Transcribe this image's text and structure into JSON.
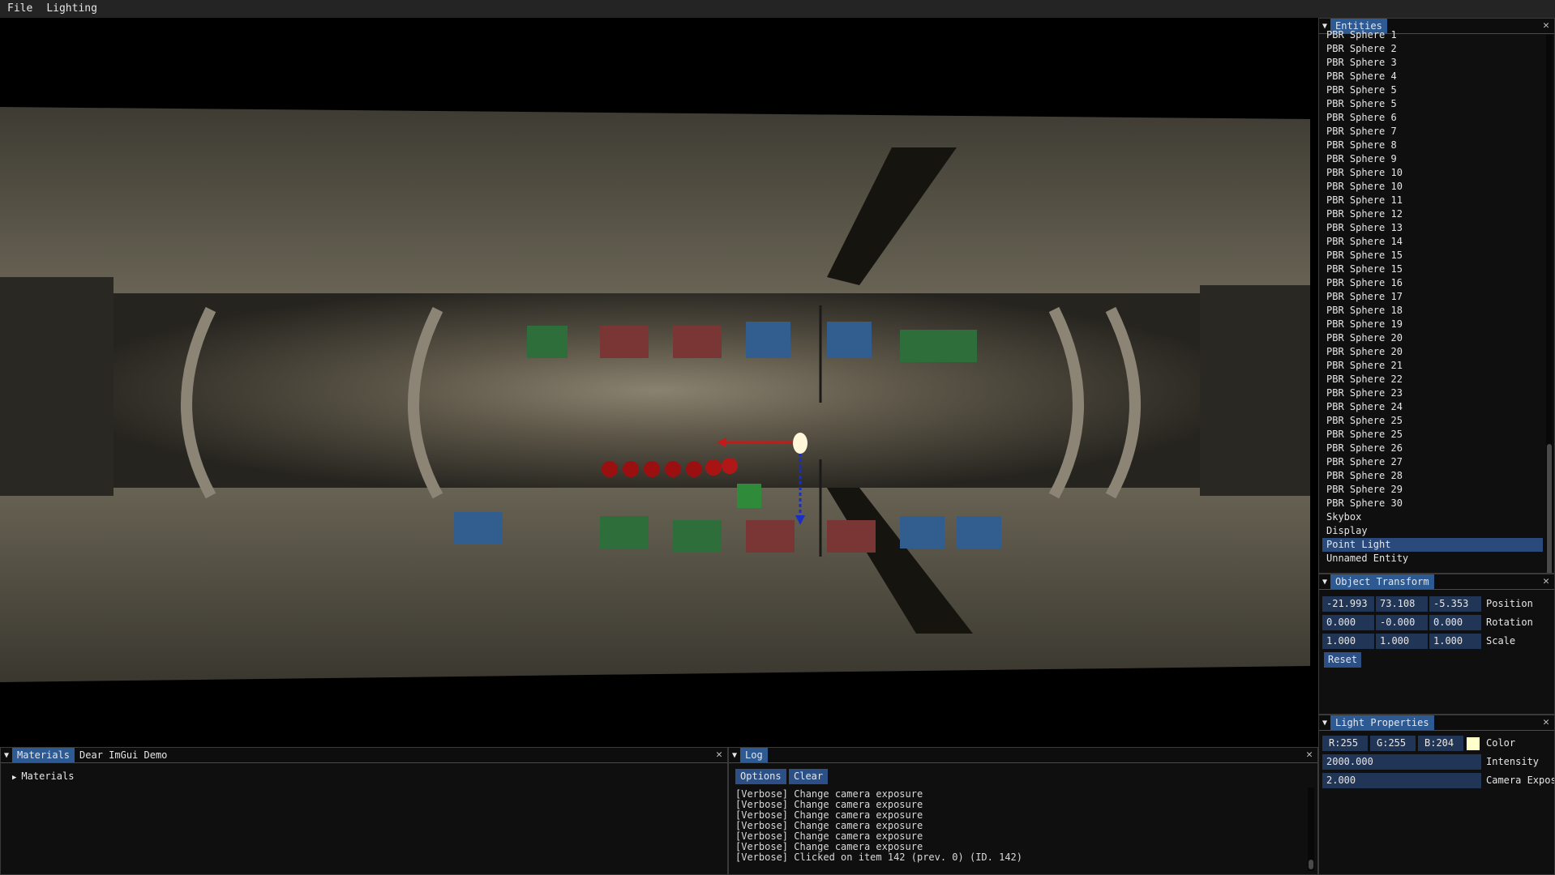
{
  "menu": {
    "items": [
      "File",
      "Lighting"
    ]
  },
  "entities_panel": {
    "title": "Entities",
    "items": [
      "PBR Sphere 1",
      "PBR Sphere 2",
      "PBR Sphere 3",
      "PBR Sphere 4",
      "PBR Sphere 5",
      "PBR Sphere 5",
      "PBR Sphere 6",
      "PBR Sphere 7",
      "PBR Sphere 8",
      "PBR Sphere 9",
      "PBR Sphere 10",
      "PBR Sphere 10",
      "PBR Sphere 11",
      "PBR Sphere 12",
      "PBR Sphere 13",
      "PBR Sphere 14",
      "PBR Sphere 15",
      "PBR Sphere 15",
      "PBR Sphere 16",
      "PBR Sphere 17",
      "PBR Sphere 18",
      "PBR Sphere 19",
      "PBR Sphere 20",
      "PBR Sphere 20",
      "PBR Sphere 21",
      "PBR Sphere 22",
      "PBR Sphere 23",
      "PBR Sphere 24",
      "PBR Sphere 25",
      "PBR Sphere 25",
      "PBR Sphere 26",
      "PBR Sphere 27",
      "PBR Sphere 28",
      "PBR Sphere 29",
      "PBR Sphere 30",
      "Skybox",
      "Display",
      "Point Light",
      "Unnamed Entity"
    ],
    "selected": "Point Light"
  },
  "transform_panel": {
    "title": "Object Transform",
    "position": {
      "label": "Position",
      "x": "-21.993",
      "y": "73.108",
      "z": "-5.353"
    },
    "rotation": {
      "label": "Rotation",
      "x": "0.000",
      "y": "-0.000",
      "z": "0.000"
    },
    "scale": {
      "label": "Scale",
      "x": "1.000",
      "y": "1.000",
      "z": "1.000"
    },
    "reset_label": "Reset"
  },
  "light_panel": {
    "title": "Light Properties",
    "r": "R:255",
    "g": "G:255",
    "b": "B:204",
    "color_label": "Color",
    "color_value": "#ffffcc",
    "intensity": "2000.000",
    "intensity_label": "Intensity",
    "exposure": "2.000",
    "exposure_label": "Camera Exposu"
  },
  "materials_panel": {
    "tabs": [
      "Materials",
      "Dear ImGui Demo"
    ],
    "tree_label": "Materials"
  },
  "log_panel": {
    "title": "Log",
    "options_label": "Options",
    "clear_label": "Clear",
    "lines": [
      "[Verbose] Change camera exposure",
      "[Verbose] Change camera exposure",
      "[Verbose] Change camera exposure",
      "[Verbose] Change camera exposure",
      "[Verbose] Change camera exposure",
      "[Verbose] Change camera exposure",
      "[Verbose] Clicked on item 142 (prev. 0) (ID. 142)"
    ]
  },
  "colors": {
    "accent": "#2e5a94",
    "field": "#213556",
    "selected": "#2b4a7c"
  }
}
